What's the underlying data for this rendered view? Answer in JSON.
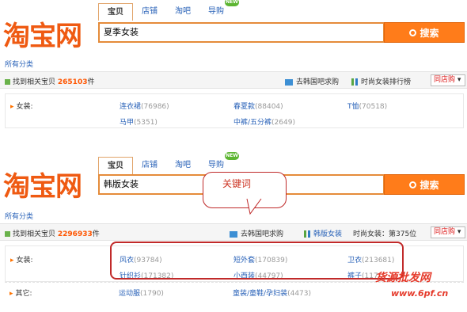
{
  "panel1": {
    "logo": "淘宝网",
    "tabs": [
      "宝贝",
      "店铺",
      "淘吧",
      "导购"
    ],
    "new_badge": "NEW",
    "search_value": "夏季女装",
    "search_button": "搜索",
    "all_categories": "所有分类",
    "found_prefix": "找到相关宝贝",
    "found_count": "265103",
    "found_suffix": "件",
    "link_korea": "去韩国吧求购",
    "link_ranking": "时尚女装排行榜",
    "same_store": "同店购",
    "category_label": "女装:",
    "categories": [
      {
        "name": "连衣裙",
        "count": "(76986)"
      },
      {
        "name": "春夏款",
        "count": "(88404)"
      },
      {
        "name": "T恤",
        "count": "(70518)"
      },
      {
        "name": "马甲",
        "count": "(5351)"
      },
      {
        "name": "中裤/五分裤",
        "count": "(2649)"
      }
    ]
  },
  "panel2": {
    "logo": "淘宝网",
    "tabs": [
      "宝贝",
      "店铺",
      "淘吧",
      "导购"
    ],
    "new_badge": "NEW",
    "search_value": "韩版女装",
    "search_button": "搜索",
    "callout": "关键词",
    "all_categories": "所有分类",
    "found_prefix": "找到相关宝贝",
    "found_count": "2296933",
    "found_suffix": "件",
    "link_korea": "去韩国吧求购",
    "link_korean_fashion": "韩版女装",
    "link_ranking": "时尚女装：第375位",
    "same_store": "同店购",
    "category_label": "女装:",
    "categories": [
      {
        "name": "风衣",
        "count": "(93784)"
      },
      {
        "name": "短外套",
        "count": "(170839)"
      },
      {
        "name": "卫衣",
        "count": "(213681)"
      },
      {
        "name": "针织衫",
        "count": "(171382)"
      },
      {
        "name": "小西装",
        "count": "(44797)"
      },
      {
        "name": "裤子",
        "count": "(117"
      }
    ],
    "other_label": "其它:",
    "other_categories": [
      {
        "name": "运动服",
        "count": "(1790)"
      },
      {
        "name": "童装/童鞋/孕妇装",
        "count": "(4473)"
      }
    ]
  },
  "watermark": {
    "line1": "货源批发网",
    "line2": "www.6pf.cn"
  },
  "colors": {
    "brand_orange": "#ef5a12",
    "button_orange": "#ff7c1a",
    "link_blue": "#2962b8",
    "count_red": "#ff5500",
    "annotation_red": "#c12a2a"
  }
}
